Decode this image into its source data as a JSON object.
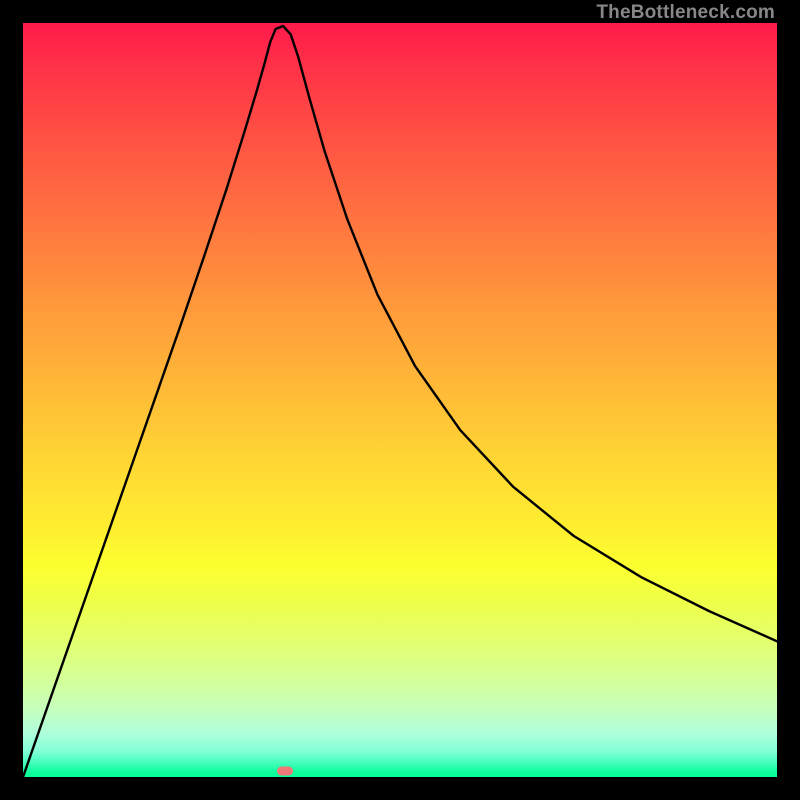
{
  "watermark": "TheBottleneck.com",
  "marker": {
    "x_frac": 0.3475,
    "y_frac": 0.992
  },
  "chart_data": {
    "type": "line",
    "title": "",
    "xlabel": "",
    "ylabel": "",
    "xlim": [
      0,
      1000
    ],
    "ylim": [
      0,
      1000
    ],
    "series": [
      {
        "name": "curve",
        "x": [
          0,
          30,
          60,
          90,
          120,
          150,
          180,
          210,
          240,
          270,
          295,
          310,
          320,
          328,
          335,
          345,
          355,
          365,
          380,
          400,
          430,
          470,
          520,
          580,
          650,
          730,
          820,
          910,
          1000
        ],
        "y": [
          0,
          86,
          172,
          258,
          344,
          430,
          516,
          602,
          690,
          780,
          860,
          910,
          945,
          975,
          992,
          996,
          985,
          955,
          900,
          830,
          740,
          640,
          545,
          460,
          385,
          320,
          265,
          220,
          180
        ]
      }
    ],
    "annotations": [
      {
        "type": "marker",
        "x": 347.5,
        "y": 992,
        "color": "#f17878"
      }
    ]
  }
}
